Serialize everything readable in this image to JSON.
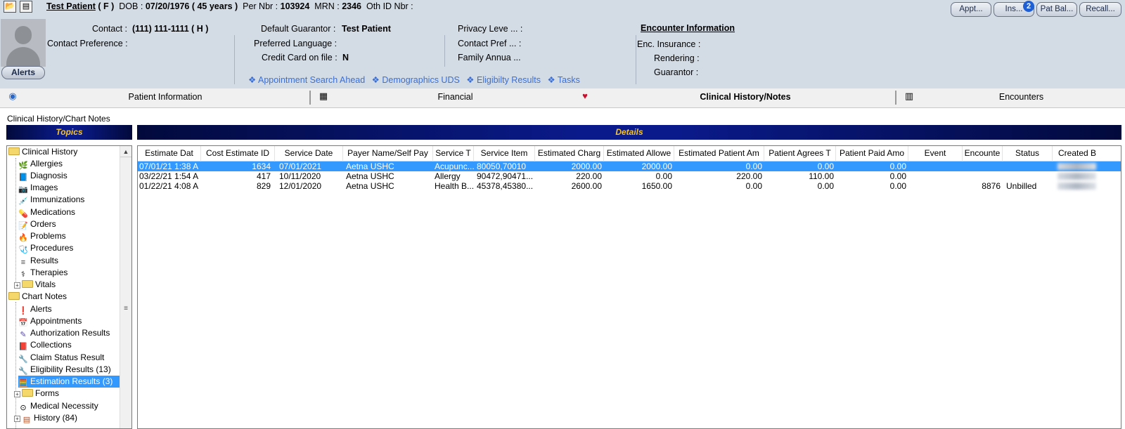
{
  "header": {
    "patient_name": "Test Patient",
    "sex": "( F )",
    "dob_label": "DOB :",
    "dob_value": "07/20/1976 ( 45 years )",
    "per_nbr_label": "Per Nbr :",
    "per_nbr_value": "103924",
    "mrn_label": "MRN :",
    "mrn_value": "2346",
    "oth_id_label": "Oth ID Nbr :",
    "contact_label": "Contact :",
    "contact_value": "(111) 111-1111 ( H )",
    "contact_pref_label": "Contact Preference :",
    "default_guarantor_label": "Default Guarantor :",
    "default_guarantor_value": "Test Patient",
    "preferred_language_label": "Preferred Language :",
    "credit_card_label": "Credit Card on file :",
    "credit_card_value": "N",
    "privacy_label": "Privacy Leve ... :",
    "contact_pref2_label": "Contact Pref ... :",
    "family_annual_label": "Family Annua ...",
    "encounter_title": "Encounter Information",
    "enc_insurance_label": "Enc. Insurance :",
    "rendering_label": "Rendering :",
    "guarantor_label": "Guarantor :",
    "alerts_button": "Alerts",
    "quick_links": [
      "❖ Appointment Search Ahead",
      "❖ Demographics UDS",
      "❖ Eligibilty Results",
      "❖ Tasks"
    ],
    "top_buttons": [
      "Appt...",
      "Ins...",
      "Pat Bal...",
      "Recall..."
    ],
    "ins_badge": "2"
  },
  "tabs": [
    {
      "label": "Patient Information",
      "icon": "globe-icon"
    },
    {
      "label": "Financial",
      "icon": "calculator-icon"
    },
    {
      "label": "Clinical History/Notes",
      "icon": "heart-icon"
    },
    {
      "label": "Encounters",
      "icon": "calendar-icon"
    }
  ],
  "section_title": "Clinical History/Chart Notes",
  "topics_title": "Topics",
  "details_title": "Details",
  "tree": [
    {
      "label": "Clinical History",
      "type": "folder"
    },
    {
      "label": "Allergies",
      "icon": "🌿"
    },
    {
      "label": "Diagnosis",
      "icon": "📘"
    },
    {
      "label": "Images",
      "icon": "📷"
    },
    {
      "label": "Immunizations",
      "icon": "💉"
    },
    {
      "label": "Medications",
      "icon": "💊"
    },
    {
      "label": "Orders",
      "icon": "📝"
    },
    {
      "label": "Problems",
      "icon": "🔥"
    },
    {
      "label": "Procedures",
      "icon": "🩺"
    },
    {
      "label": "Results",
      "icon": "≡"
    },
    {
      "label": "Therapies",
      "icon": "⚕"
    },
    {
      "label": "Vitals",
      "type": "subfolder"
    },
    {
      "label": "Chart Notes",
      "type": "folder"
    },
    {
      "label": "Alerts",
      "icon": "❗"
    },
    {
      "label": "Appointments",
      "icon": "📅"
    },
    {
      "label": "Authorization Results",
      "icon": "✎"
    },
    {
      "label": "Collections",
      "icon": "📕"
    },
    {
      "label": "Claim Status Result",
      "icon": "🔧"
    },
    {
      "label": "Eligibility Results (13)",
      "icon": "🔧"
    },
    {
      "label": "Estimation Results (3)",
      "icon": "🧮",
      "selected": true
    },
    {
      "label": "Forms",
      "type": "subfolder"
    },
    {
      "label": "Medical Necessity",
      "icon": "⊙"
    },
    {
      "label": "History (84)",
      "type": "subfolder-icon"
    }
  ],
  "columns": [
    "Estimate Dat",
    "Cost Estimate ID",
    "Service Date",
    "Payer Name/Self Pay",
    "Service T",
    "Service Item",
    "Estimated Charg",
    "Estimated Allowe",
    "Estimated Patient Am",
    "Patient Agrees T",
    "Patient Paid Amo",
    "Event",
    "Encounte",
    "Status",
    "Created B"
  ],
  "rows": [
    {
      "estimate_date": "07/01/21 1:38 A",
      "cost_estimate_id": "1634",
      "service_date": "07/01/2021",
      "payer": "Aetna USHC",
      "service_type": "Acupunc...",
      "service_item": "80050,70010",
      "est_charge": "2000.00",
      "est_allowed": "2000.00",
      "est_patient_amt": "0.00",
      "patient_agrees": "0.00",
      "patient_paid": "0.00",
      "event": "",
      "encounter": "",
      "status": "",
      "selected": true
    },
    {
      "estimate_date": "03/22/21 1:54 A",
      "cost_estimate_id": "417",
      "service_date": "10/11/2020",
      "payer": "Aetna USHC",
      "service_type": "Allergy",
      "service_item": "90472,90471...",
      "est_charge": "220.00",
      "est_allowed": "0.00",
      "est_patient_amt": "220.00",
      "patient_agrees": "110.00",
      "patient_paid": "0.00",
      "event": "",
      "encounter": "",
      "status": ""
    },
    {
      "estimate_date": "01/22/21 4:08 A",
      "cost_estimate_id": "829",
      "service_date": "12/01/2020",
      "payer": "Aetna USHC",
      "service_type": "Health B...",
      "service_item": "45378,45380...",
      "est_charge": "2600.00",
      "est_allowed": "1650.00",
      "est_patient_amt": "0.00",
      "patient_agrees": "0.00",
      "patient_paid": "0.00",
      "event": "",
      "encounter": "8876",
      "status": "Unbilled"
    }
  ]
}
